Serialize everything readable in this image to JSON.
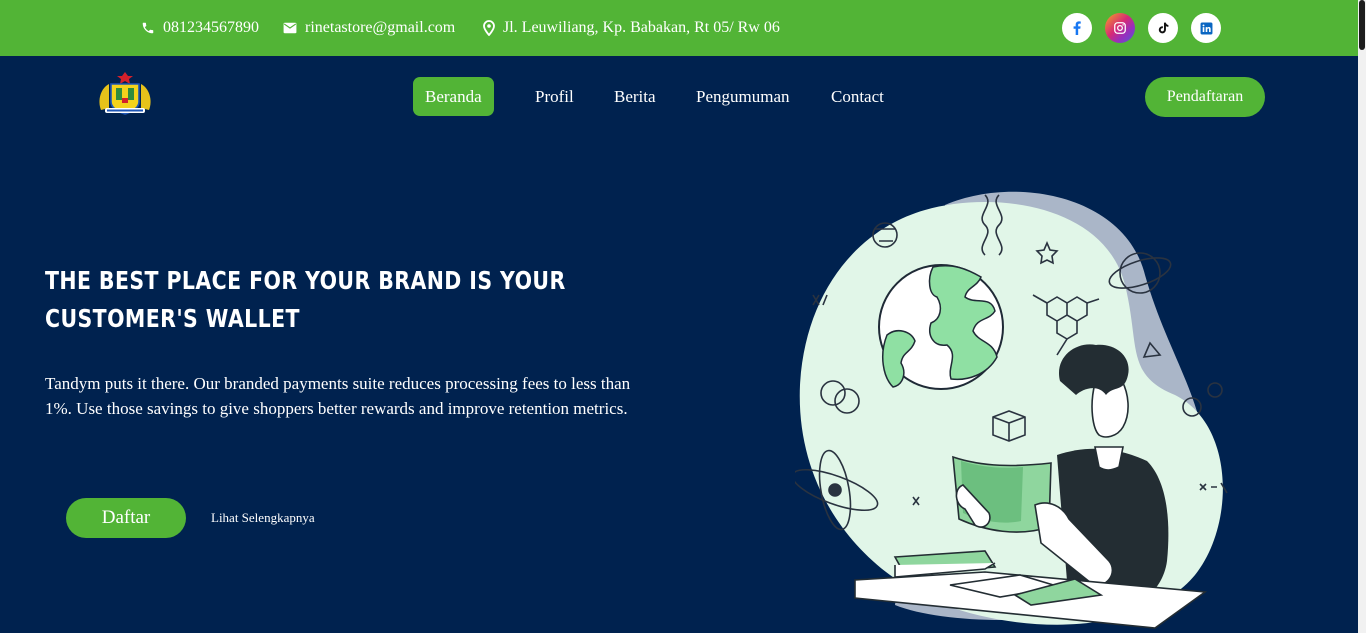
{
  "topbar": {
    "phone": "081234567890",
    "email": "rinetastore@gmail.com",
    "address": "Jl. Leuwiliang, Kp. Babakan, Rt 05/ Rw 06"
  },
  "social": [
    {
      "icon": "facebook-icon"
    },
    {
      "icon": "instagram-icon"
    },
    {
      "icon": "tiktok-icon"
    },
    {
      "icon": "linkedin-icon"
    }
  ],
  "nav": {
    "items": [
      {
        "label": "Beranda",
        "active": true
      },
      {
        "label": "Profil"
      },
      {
        "label": "Berita"
      },
      {
        "label": "Pengumuman"
      },
      {
        "label": "Contact"
      }
    ],
    "register_label": "Pendaftaran"
  },
  "hero": {
    "title": "THE BEST PLACE FOR YOUR BRAND IS YOUR CUSTOMER'S WALLET",
    "description": "Tandym puts it there. Our branded payments suite reduces processing fees to less than 1%. Use those savings to give shoppers better rewards and improve retention metrics.",
    "primary_button": "Daftar",
    "secondary_link": "Lihat Selengkapnya"
  },
  "colors": {
    "accent": "#52b436",
    "background": "#00224f"
  }
}
